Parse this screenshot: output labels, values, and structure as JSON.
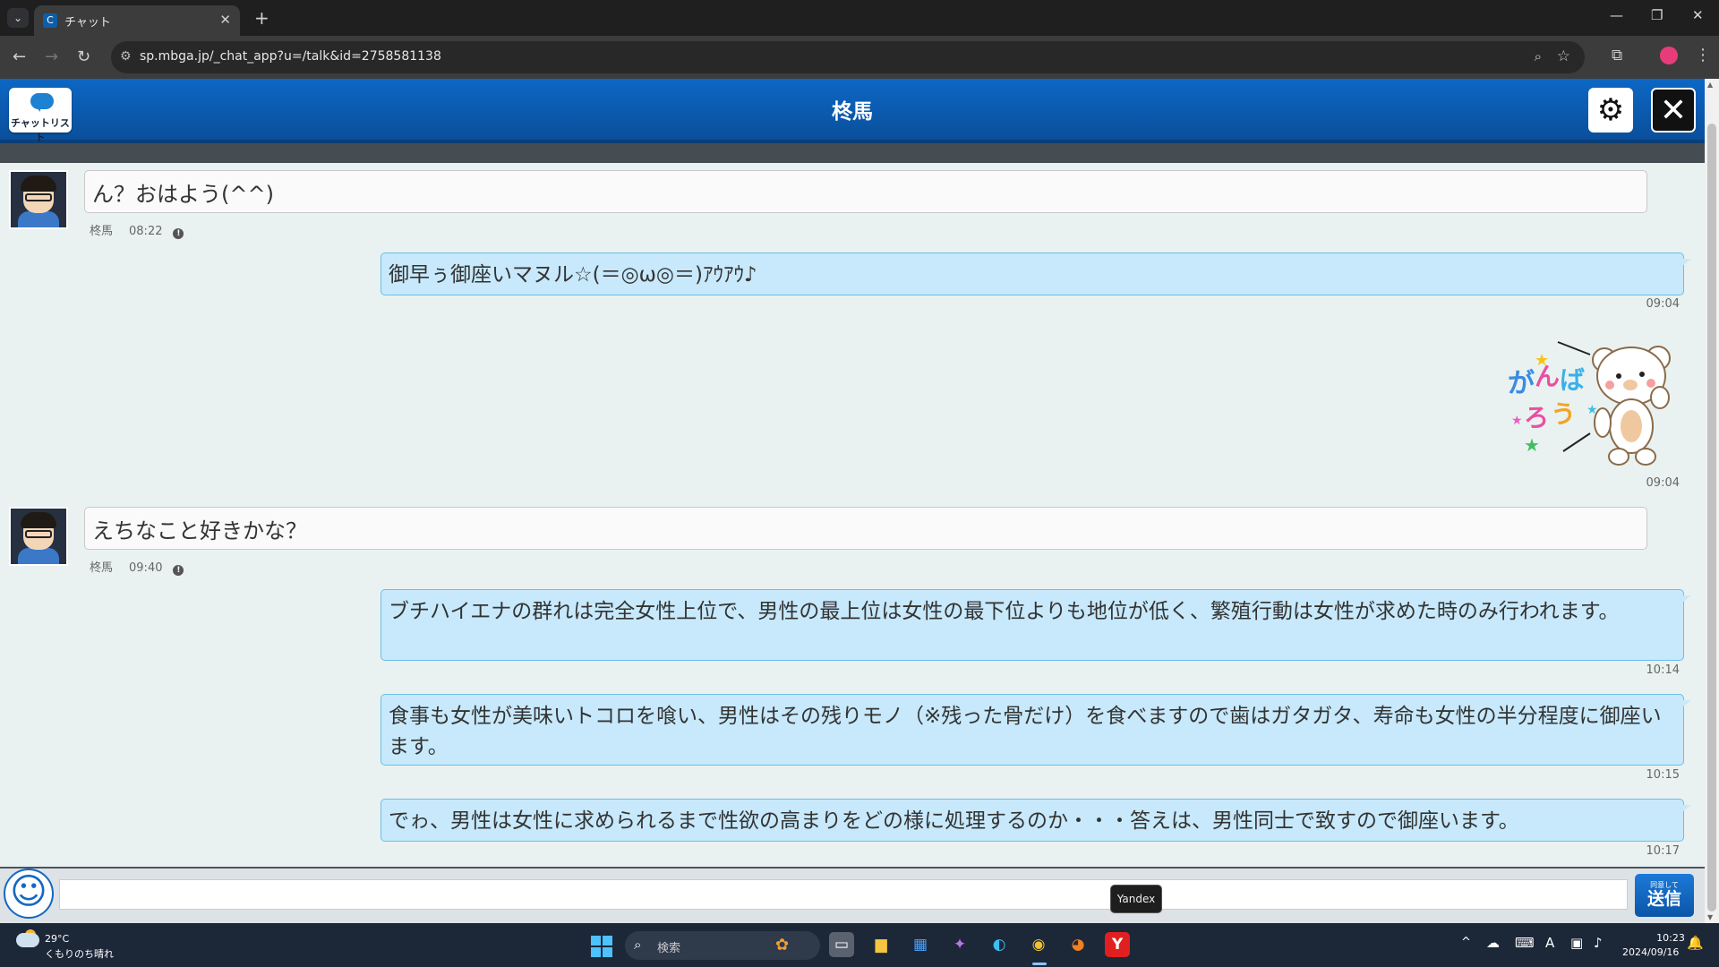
{
  "browser": {
    "tab_title": "チャット",
    "url": "sp.mbga.jp/_chat_app?u=/talk&id=2758581138",
    "tab_close": "✕",
    "new_tab": "+",
    "minimize": "—",
    "restore": "❐",
    "close": "✕"
  },
  "header": {
    "chat_list_label": "チャットリスト",
    "title": "柊馬"
  },
  "messages": [
    {
      "dir": "in",
      "text": "ん？おはよう(^^)",
      "sender": "柊馬",
      "time": "08:22"
    },
    {
      "dir": "out",
      "text": "御早ぅ御座いマヌル☆(＝◎ω◎＝)ｱｳｱｳ♪",
      "time": "09:04"
    },
    {
      "dir": "out",
      "sticker": "ganbarou-bear-sticker",
      "sticker_text": "がんばろう",
      "time": "09:04"
    },
    {
      "dir": "in",
      "text": "えちなこと好きかな？",
      "sender": "柊馬",
      "time": "09:40"
    },
    {
      "dir": "out",
      "text": "ブチハイエナの群れは完全女性上位で、男性の最上位は女性の最下位よりも地位が低く、繁殖行動は女性が求めた時のみ行われます。",
      "time": "10:14"
    },
    {
      "dir": "out",
      "text": "食事も女性が美味いトコロを喰い、男性はその残りモノ（※残った骨だけ）を食べますので歯はガタガタ、寿命も女性の半分程度に御座います。",
      "time": "10:15"
    },
    {
      "dir": "out",
      "text": "でゎ、男性は女性に求められるまで性欲の高まりをどの様に処理するのか・・・答えは、男性同士で致すので御座います。",
      "time": "10:17"
    }
  ],
  "input": {
    "placeholder": "",
    "send_small": "同意して",
    "send_main": "送信"
  },
  "tooltip": "Yandex",
  "taskbar": {
    "temperature": "29°C",
    "weather": "くもりのち晴れ",
    "search_label": "検索",
    "time": "10:23",
    "date": "2024/09/16",
    "yandex_label": "Y",
    "ime_label": "A"
  },
  "colors": {
    "header_blue": "#0a5bb0",
    "outgoing_bubble": "#c7e9fb",
    "incoming_bubble": "#fafafa"
  }
}
